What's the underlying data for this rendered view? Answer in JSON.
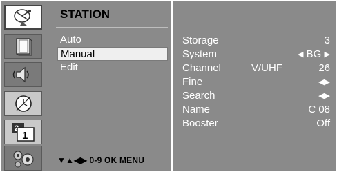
{
  "sidebar": {
    "icons": [
      {
        "name": "satellite-dish-icon",
        "active": true
      },
      {
        "name": "picture-icon",
        "active": false
      },
      {
        "name": "sound-icon",
        "active": false
      },
      {
        "name": "clock-icon",
        "active": false
      },
      {
        "name": "channel-number-icon",
        "active": false,
        "digit": "1",
        "small_digit": "2"
      },
      {
        "name": "settings-gears-icon",
        "active": false
      }
    ]
  },
  "menu": {
    "title": "STATION",
    "items": [
      {
        "label": "Auto",
        "selected": false
      },
      {
        "label": "Manual",
        "selected": true
      },
      {
        "label": "Edit",
        "selected": false
      }
    ],
    "footer": "▼▲◀▶ 0-9 OK MENU"
  },
  "settings": {
    "storage": {
      "label": "Storage",
      "value": "3"
    },
    "system": {
      "label": "System",
      "value": "BG"
    },
    "channel": {
      "label": "Channel",
      "band": "V/UHF",
      "value": "26"
    },
    "fine": {
      "label": "Fine"
    },
    "search": {
      "label": "Search"
    },
    "name": {
      "label": "Name",
      "value": "C 08"
    },
    "booster": {
      "label": "Booster",
      "value": "Off"
    }
  },
  "colors": {
    "panel": "#8a8a8a",
    "selected": "#efefef",
    "text": "#ffffff"
  }
}
